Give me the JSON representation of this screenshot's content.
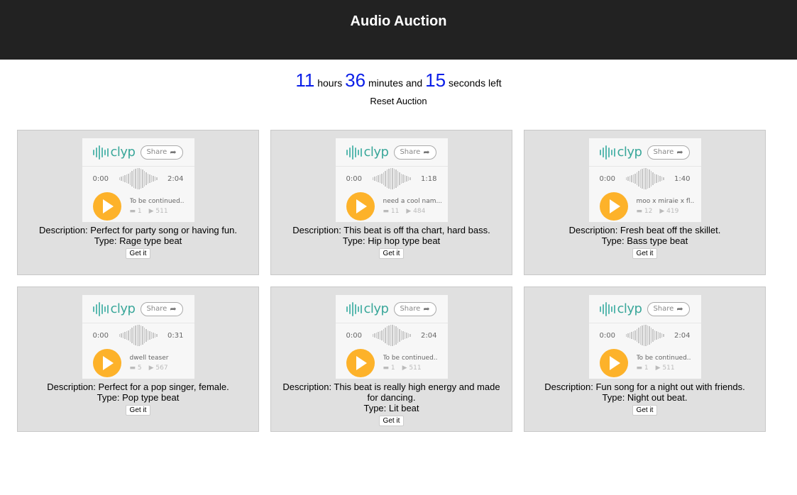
{
  "header": {
    "title": "Audio Auction"
  },
  "timer": {
    "hours": "11",
    "hours_label": "hours",
    "minutes": "36",
    "minutes_label": "minutes and",
    "seconds": "15",
    "seconds_label": "seconds left"
  },
  "reset_label": "Reset Auction",
  "colors": {
    "header_bg": "#222222",
    "timer_num": "#0b1fe8",
    "play_button": "#fdb22a",
    "logo": "#3aa79a"
  },
  "player": {
    "logo_text": "clyp",
    "share_label": "Share",
    "share_icon": "arrow-icon",
    "comment_icon": "comment-icon",
    "play_icon": "play-icon"
  },
  "cards": [
    {
      "start": "0:00",
      "duration": "2:04",
      "track": "To be continued..",
      "comments": "1",
      "plays": "511",
      "description": "Description: Perfect for party song or having fun.",
      "type": "Type: Rage type beat",
      "button": "Get it"
    },
    {
      "start": "0:00",
      "duration": "1:18",
      "track": "need a cool nam...",
      "comments": "11",
      "plays": "484",
      "description": "Description: This beat is off tha chart, hard bass.",
      "type": "Type: Hip hop type beat",
      "button": "Get it"
    },
    {
      "start": "0:00",
      "duration": "1:40",
      "track": "moo x miraie x fl...",
      "comments": "12",
      "plays": "419",
      "description": "Description: Fresh beat off the skillet.",
      "type": "Type: Bass type beat",
      "button": "Get it"
    },
    {
      "start": "0:00",
      "duration": "0:31",
      "track": "dwell teaser",
      "comments": "5",
      "plays": "567",
      "description": "Description: Perfect for a pop singer, female.",
      "type": "Type: Pop type beat",
      "button": "Get it"
    },
    {
      "start": "0:00",
      "duration": "2:04",
      "track": "To be continued..",
      "comments": "1",
      "plays": "511",
      "description": "Description: This beat is really high energy and made for dancing.",
      "type": "Type: Lit beat",
      "button": "Get it"
    },
    {
      "start": "0:00",
      "duration": "2:04",
      "track": "To be continued..",
      "comments": "1",
      "plays": "511",
      "description": "Description: Fun song for a night out with friends.",
      "type": "Type: Night out beat.",
      "button": "Get it"
    }
  ]
}
